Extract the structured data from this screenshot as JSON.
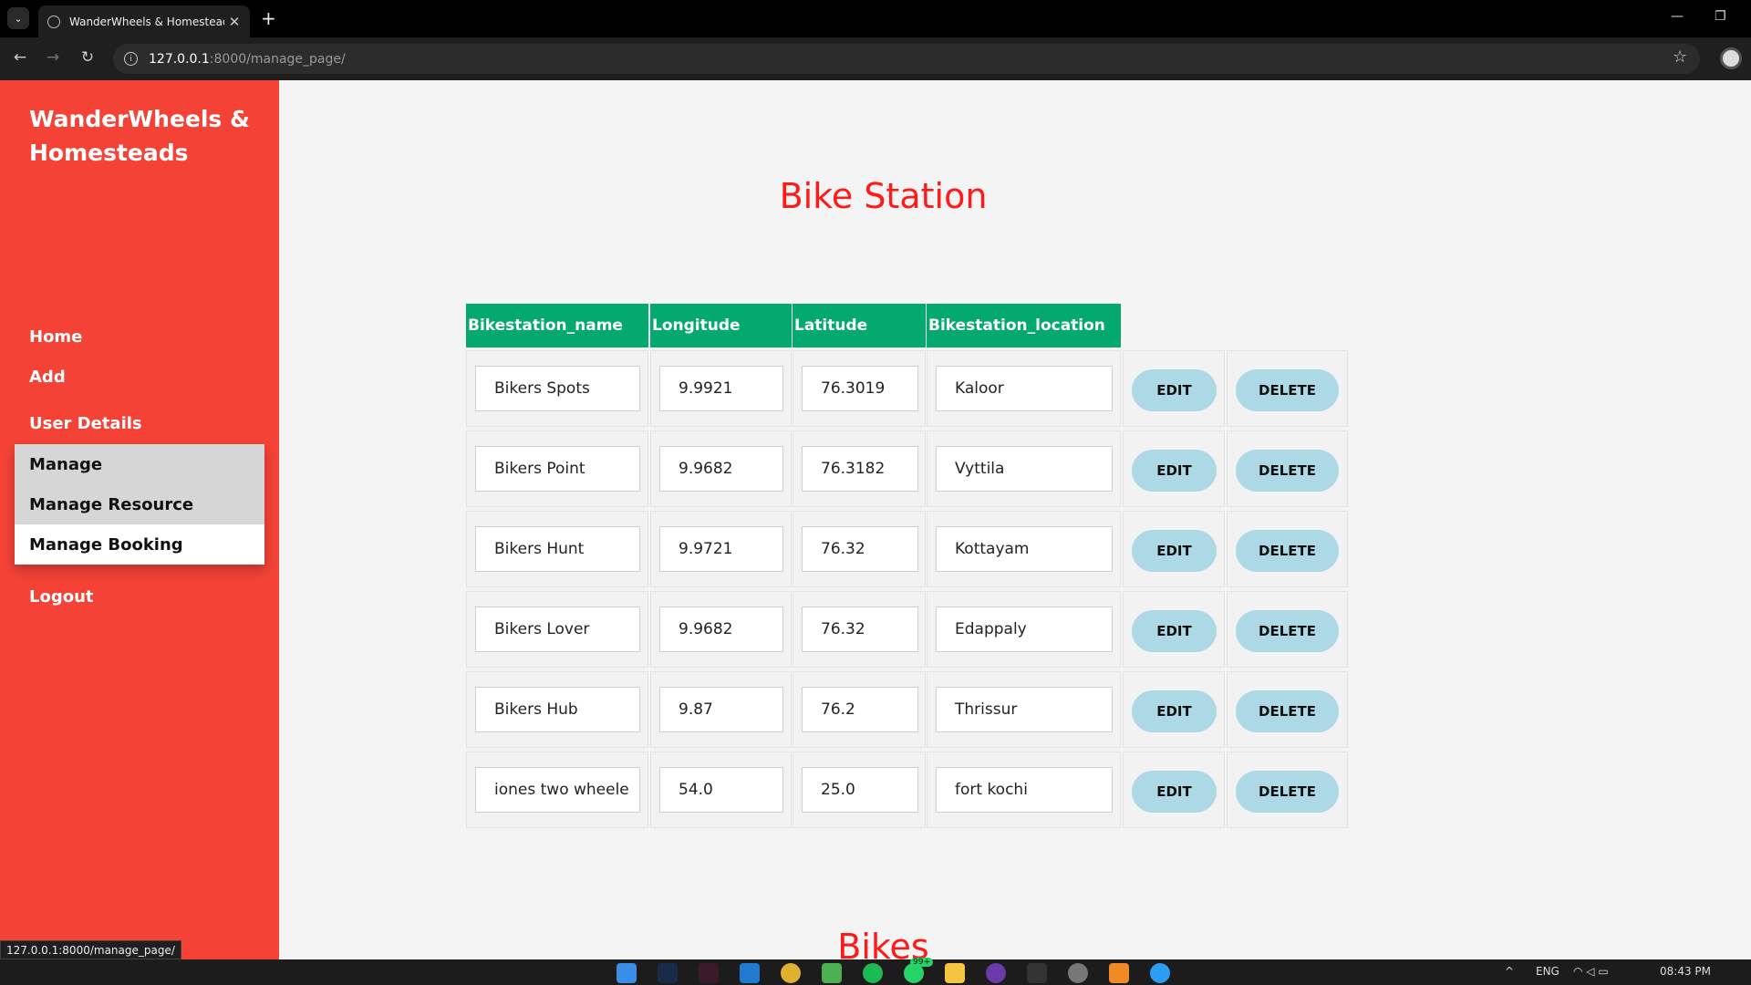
{
  "browser": {
    "tab_title": "WanderWheels & Homesteads",
    "tab_close": "✕",
    "new_tab": "+",
    "url_host": "127.0.0.1",
    "url_rest": ":8000/manage_page/",
    "minimize": "—",
    "restore": "❐",
    "status_url": "127.0.0.1:8000/manage_page/"
  },
  "sidebar": {
    "brand": "WanderWheels & Homesteads",
    "links": {
      "home": "Home",
      "add": "Add",
      "user_details": "User Details",
      "logout": "Logout"
    },
    "dropdown": {
      "manage": "Manage",
      "manage_resource": "Manage Resource",
      "manage_booking": "Manage Booking"
    }
  },
  "main": {
    "title": "Bike Station",
    "next_title": "Bikes",
    "columns": [
      "Bikestation_name",
      "Longitude",
      "Latitude",
      "Bikestation_location"
    ],
    "edit_label": "EDIT",
    "delete_label": "DELETE",
    "rows": [
      {
        "name": "Bikers Spots",
        "longitude": "9.9921",
        "latitude": "76.3019",
        "location": "Kaloor"
      },
      {
        "name": "Bikers Point",
        "longitude": "9.9682",
        "latitude": "76.3182",
        "location": "Vyttila"
      },
      {
        "name": "Bikers Hunt",
        "longitude": "9.9721",
        "latitude": "76.32",
        "location": "Kottayam"
      },
      {
        "name": "Bikers Lover",
        "longitude": "9.9682",
        "latitude": "76.32",
        "location": "Edappaly"
      },
      {
        "name": "Bikers Hub",
        "longitude": "9.87",
        "latitude": "76.2",
        "location": "Thrissur"
      },
      {
        "name": "iones two wheele",
        "longitude": "54.0",
        "latitude": "25.0",
        "location": "fort kochi"
      }
    ]
  },
  "taskbar": {
    "language": "ENG",
    "time": "08:43 PM",
    "badge": "99+"
  }
}
